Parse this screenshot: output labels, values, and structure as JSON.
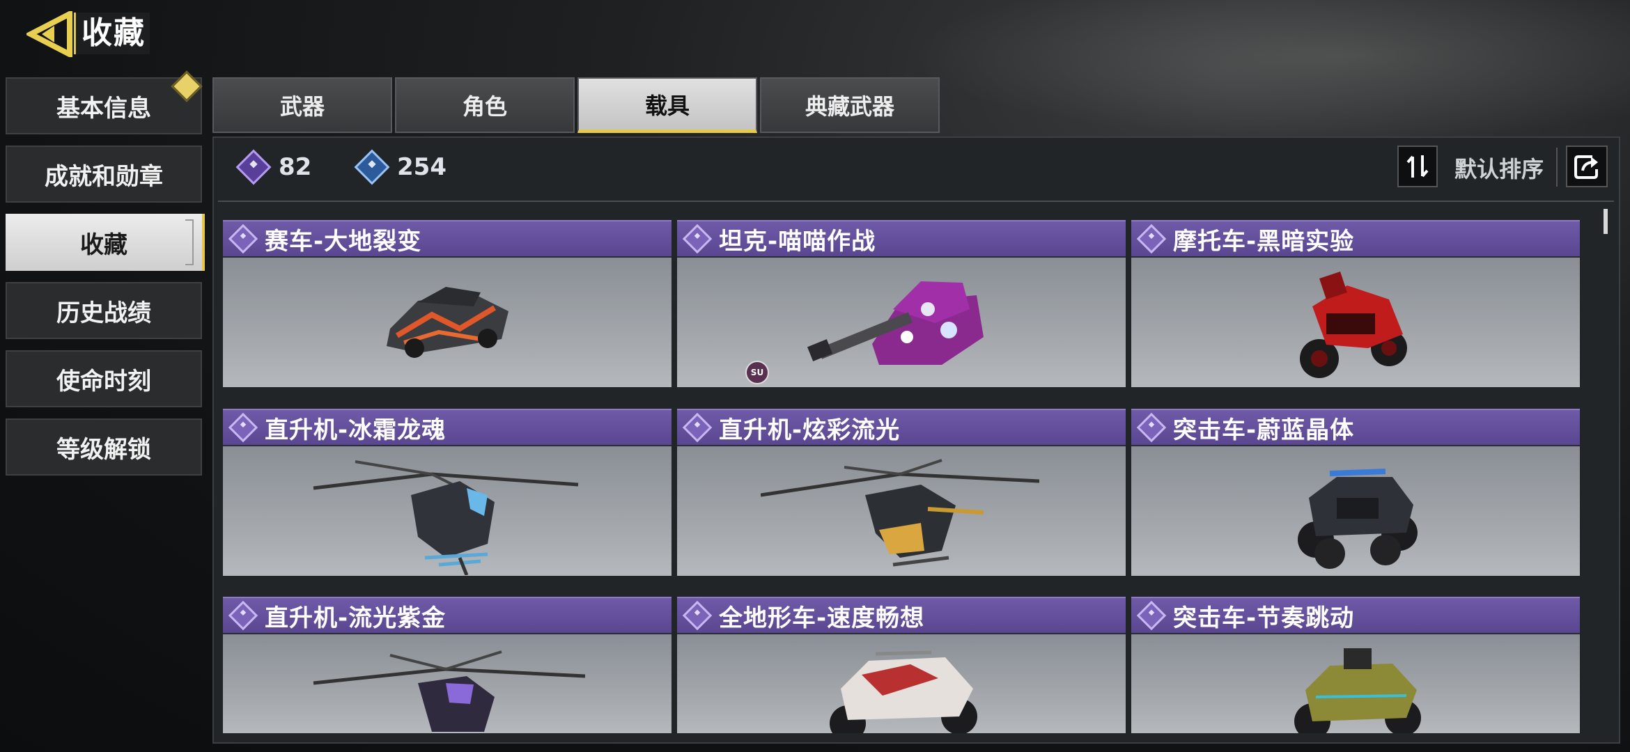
{
  "header": {
    "title": "收藏",
    "back_icon": "back-arrow-icon"
  },
  "sidebar": {
    "items": [
      {
        "label": "基本信息"
      },
      {
        "label": "成就和勋章"
      },
      {
        "label": "收藏"
      },
      {
        "label": "历史战绩"
      },
      {
        "label": "使命时刻"
      },
      {
        "label": "等级解锁"
      }
    ],
    "active_index": 2
  },
  "tabs": {
    "items": [
      {
        "label": "武器"
      },
      {
        "label": "角色"
      },
      {
        "label": "载具"
      },
      {
        "label": "典藏武器"
      }
    ],
    "active_index": 2
  },
  "toolbar": {
    "currency_purple": "82",
    "currency_blue": "254",
    "sort_label": "默认排序"
  },
  "vehicles": [
    {
      "name": "赛车-大地裂变",
      "kind": "car"
    },
    {
      "name": "坦克-喵喵作战",
      "kind": "tank",
      "badge": "SU"
    },
    {
      "name": "摩托车-黑暗实验",
      "kind": "motorcycle"
    },
    {
      "name": "直升机-冰霜龙魂",
      "kind": "helicopter"
    },
    {
      "name": "直升机-炫彩流光",
      "kind": "helicopter"
    },
    {
      "name": "突击车-蔚蓝晶体",
      "kind": "buggy"
    },
    {
      "name": "直升机-流光紫金",
      "kind": "helicopter"
    },
    {
      "name": "全地形车-速度畅想",
      "kind": "atv"
    },
    {
      "name": "突击车-节奏跳动",
      "kind": "buggy"
    }
  ],
  "colors": {
    "accent_gold": "#e7c94a",
    "card_header_purple": "#6f5aa8",
    "panel_bg": "#222527"
  }
}
